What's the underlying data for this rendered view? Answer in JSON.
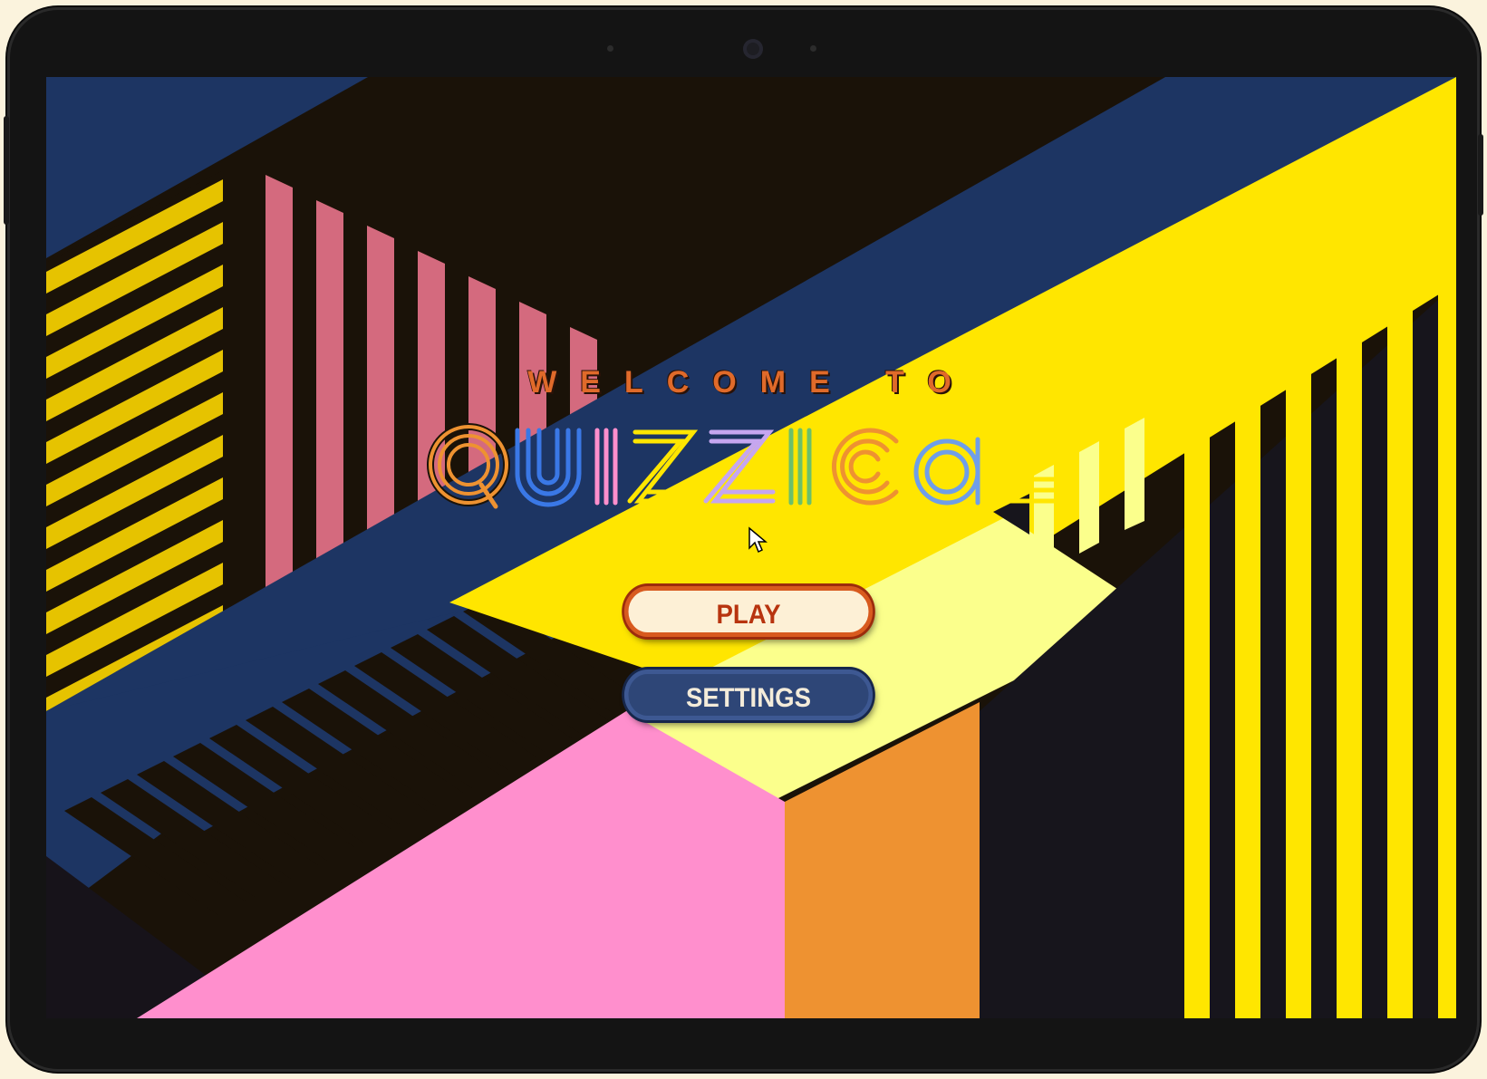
{
  "app": {
    "welcome_text": "WELCOME TO",
    "title_logo_text": "QUIZZICAL"
  },
  "menu": {
    "play_label": "PLAY",
    "settings_label": "SETTINGS"
  },
  "colors": {
    "navy": "#1d3563",
    "dark": "#1a1208",
    "yellow": "#ffe600",
    "light_yellow": "#fbff8c",
    "pink_stripe": "#d46a7e",
    "pink": "#ff8fcd",
    "orange": "#ee9231",
    "play_border": "#d85a1e",
    "settings_fill": "#2e4677"
  },
  "icons": [
    "mouse-pointer-icon"
  ]
}
